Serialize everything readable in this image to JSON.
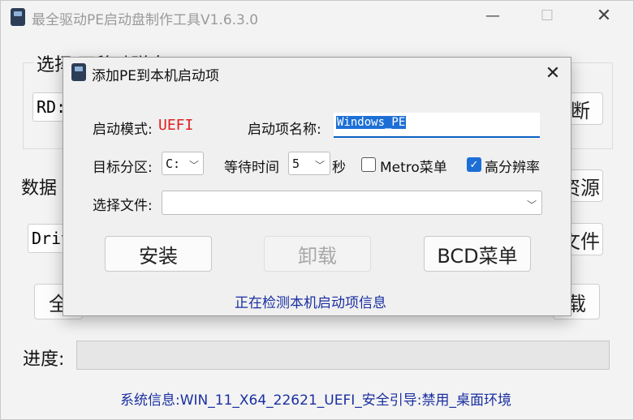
{
  "main_window": {
    "title": "最全驱动PE启动盘制作工具V1.6.3.0",
    "group_label": "选择 可移动磁盘",
    "device_value": "RD:",
    "data_label": "数据",
    "driver_value": "Driv",
    "right_btn_top": "断",
    "right_btn_resource": "资源",
    "right_btn_file": "文件",
    "btn_left": "全",
    "btn_right": "载",
    "progress_label": "进度:",
    "progress_value": 0,
    "system_info": "系统信息:WIN_11_X64_22621_UEFI_安全引导:禁用_桌面环境"
  },
  "dialog": {
    "title": "添加PE到本机启动项",
    "boot_mode_label": "启动模式:",
    "boot_mode_value": "UEFI",
    "boot_name_label": "启动项名称:",
    "boot_name_value": "Windows_PE",
    "target_label": "目标分区:",
    "target_value": "C:",
    "wait_label": "等待时间",
    "wait_value": "5",
    "wait_unit": "秒",
    "metro_label": "Metro菜单",
    "metro_checked": false,
    "hires_label": "高分辨率",
    "hires_checked": true,
    "file_label": "选择文件:",
    "file_value": "",
    "install_label": "安装",
    "uninstall_label": "卸载",
    "bcd_label": "BCD菜单",
    "status_text": "正在检测本机启动项信息"
  }
}
